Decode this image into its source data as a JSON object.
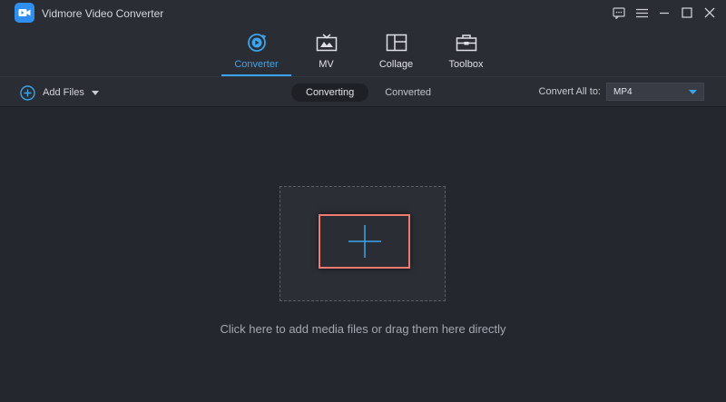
{
  "app": {
    "title": "Vidmore Video Converter",
    "accent_color": "#3aa5ee",
    "logo_icon": "video-camera-logo"
  },
  "window_controls": [
    {
      "name": "feedback-icon"
    },
    {
      "name": "menu-icon"
    },
    {
      "name": "minimize-icon"
    },
    {
      "name": "maximize-icon"
    },
    {
      "name": "close-icon"
    }
  ],
  "nav": {
    "tabs": [
      {
        "label": "Converter",
        "icon": "converter-icon",
        "active": true
      },
      {
        "label": "MV",
        "icon": "mv-icon",
        "active": false
      },
      {
        "label": "Collage",
        "icon": "collage-icon",
        "active": false
      },
      {
        "label": "Toolbox",
        "icon": "toolbox-icon",
        "active": false
      }
    ]
  },
  "toolbar": {
    "add_files_label": "Add Files",
    "status_tabs": [
      {
        "label": "Converting",
        "active": true
      },
      {
        "label": "Converted",
        "active": false
      }
    ],
    "convert_all_label": "Convert All to:",
    "format_value": "MP4"
  },
  "main": {
    "hint": "Click here to add media files or drag them here directly",
    "highlight_color": "#f07a70"
  }
}
